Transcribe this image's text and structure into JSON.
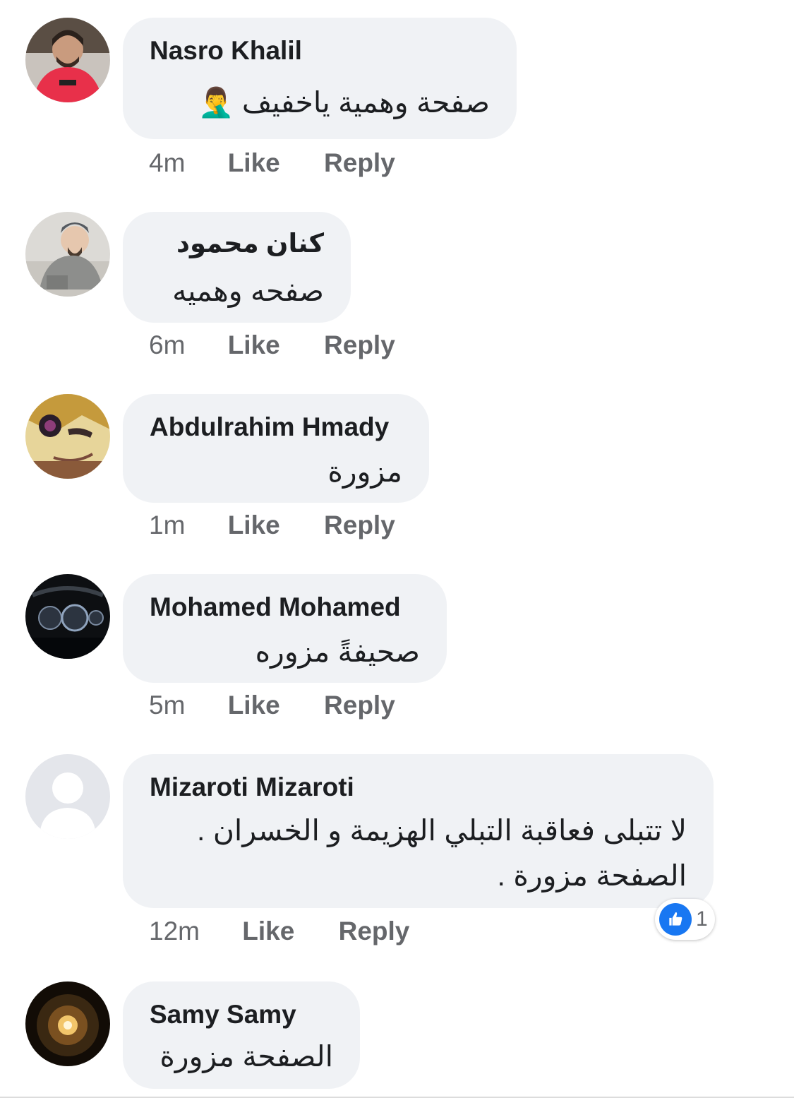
{
  "comments": [
    {
      "author": "Nasro Khalil",
      "text_lines": [
        "صفحة وهمية ياخفيف 🤦‍♂️"
      ],
      "time": "4m",
      "like_label": "Like",
      "reply_label": "Reply"
    },
    {
      "author": "كنان محمود",
      "text_lines": [
        "صفحه وهميه"
      ],
      "time": "6m",
      "like_label": "Like",
      "reply_label": "Reply"
    },
    {
      "author": "Abdulrahim Hmady",
      "text_lines": [
        "مزورة"
      ],
      "time": "1m",
      "like_label": "Like",
      "reply_label": "Reply"
    },
    {
      "author": "Mohamed Mohamed",
      "text_lines": [
        "صحيفةً مزوره"
      ],
      "time": "5m",
      "like_label": "Like",
      "reply_label": "Reply"
    },
    {
      "author": "Mizaroti Mizaroti",
      "text_lines": [
        "لا تتبلى فعاقبة التبلي الهزيمة و الخسران .",
        "الصفحة مزورة ."
      ],
      "time": "12m",
      "like_label": "Like",
      "reply_label": "Reply",
      "reaction_count": "1",
      "reaction_icon": "thumbs-up-icon",
      "reaction_color": "#1877f2"
    },
    {
      "author": "Samy Samy",
      "text_lines": [
        "الصفحة مزورة"
      ]
    }
  ],
  "colors": {
    "bubble": "#f0f2f5",
    "meta": "#65676b",
    "accent": "#1877f2"
  }
}
